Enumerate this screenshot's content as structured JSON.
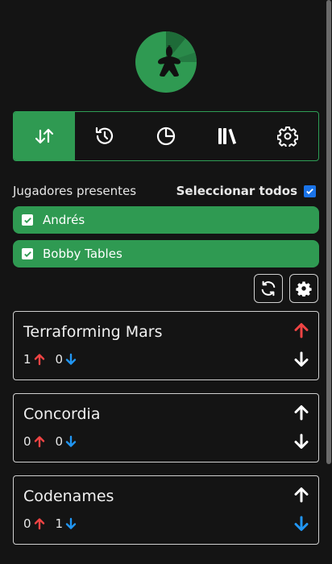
{
  "logo": {
    "icon": "meeple-icon",
    "colors": {
      "main": "#2f9a52",
      "dark": "#1e6b38"
    }
  },
  "tabs": [
    {
      "name": "sort",
      "icon": "sort-arrows-icon",
      "active": true
    },
    {
      "name": "history",
      "icon": "history-icon",
      "active": false
    },
    {
      "name": "stats",
      "icon": "pie-chart-icon",
      "active": false
    },
    {
      "name": "library",
      "icon": "library-icon",
      "active": false
    },
    {
      "name": "settings",
      "icon": "gear-icon",
      "active": false
    }
  ],
  "players_label": "Jugadores presentes",
  "select_all_label": "Seleccionar todos",
  "select_all_checked": true,
  "players": [
    {
      "name": "Andrés",
      "checked": true
    },
    {
      "name": "Bobby Tables",
      "checked": true
    }
  ],
  "actions": {
    "refresh_icon": "refresh-icon",
    "settings_icon": "gear-icon"
  },
  "games": [
    {
      "name": "Terraforming Mars",
      "up_count": "1",
      "down_count": "0",
      "up_voted": true,
      "down_voted": false
    },
    {
      "name": "Concordia",
      "up_count": "0",
      "down_count": "0",
      "up_voted": false,
      "down_voted": false
    },
    {
      "name": "Codenames",
      "up_count": "0",
      "down_count": "1",
      "up_voted": false,
      "down_voted": true
    }
  ],
  "colors": {
    "accent": "#2f9a52",
    "up": "#f04444",
    "down": "#2196f3",
    "neutral": "#ffffff"
  }
}
